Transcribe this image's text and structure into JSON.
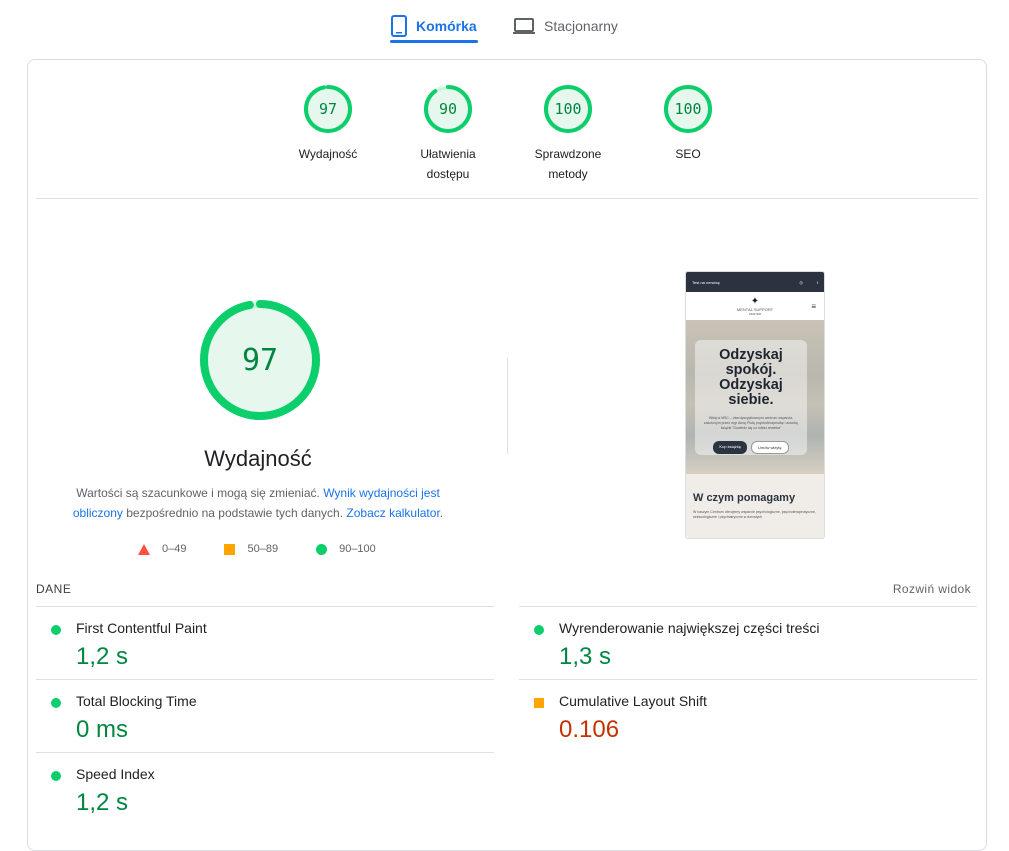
{
  "tabs": [
    {
      "label": "Komórka",
      "icon": "smartphone-icon",
      "active": true
    },
    {
      "label": "Stacjonarny",
      "icon": "laptop-icon",
      "active": false
    }
  ],
  "colors": {
    "accent": "#1a73e8",
    "pass": "#0cce6b",
    "pass_text": "#018642",
    "average": "#ffa400",
    "average_text": "#c33300",
    "fail": "#ff4e42"
  },
  "scores": [
    {
      "value": "97",
      "label_line1": "Wydajność",
      "label_line2": ""
    },
    {
      "value": "90",
      "label_line1": "Ułatwienia",
      "label_line2": "dostępu"
    },
    {
      "value": "100",
      "label_line1": "Sprawdzone",
      "label_line2": "metody"
    },
    {
      "value": "100",
      "label_line1": "SEO",
      "label_line2": ""
    }
  ],
  "main_score": {
    "value": "97",
    "title": "Wydajność"
  },
  "description": {
    "text1": "Wartości są szacunkowe i mogą się zmieniać. ",
    "link1": "Wynik wydajności jest obliczony",
    "text2": " bezpośrednio na podstawie tych danych. ",
    "link2": "Zobacz kalkulator",
    "text3": "."
  },
  "legend": [
    {
      "range": "0–49",
      "shape": "triangle"
    },
    {
      "range": "50–89",
      "shape": "square"
    },
    {
      "range": "90–100",
      "shape": "circle"
    }
  ],
  "screenshot": {
    "topbar": "Test na nerwicę",
    "logo": "MENTAL SUPPORT",
    "logo_sub": "CENTER",
    "hero_heading": "Odzyskaj spokój. Odzyskaj siebie.",
    "hero_text": "Witaj w MSC – interdyscyplinarnym centrum wsparcia, założonym przez mgr Annę Plutę psychoterapeutkę i autorkę książki \"Dowiedz się co lubisz rewelka\"",
    "btn1": "Kup książkę",
    "btn2": "Umów wizytę",
    "section_heading": "W czym pomagamy",
    "section_text": "W naszym Centrum oferujemy wsparcie psychologiczne, psychoterapeutyczne, seksuologiczne i psychiatryczne w dorosłych"
  },
  "metrics_header": {
    "title": "DANE",
    "expand": "Rozwiń widok"
  },
  "metrics": [
    {
      "name": "First Contentful Paint",
      "value": "1,2 s",
      "status": "pass"
    },
    {
      "name": "Wyrenderowanie największej części treści",
      "value": "1,3 s",
      "status": "pass"
    },
    {
      "name": "Total Blocking Time",
      "value": "0 ms",
      "status": "pass"
    },
    {
      "name": "Cumulative Layout Shift",
      "value": "0.106",
      "status": "average"
    },
    {
      "name": "Speed Index",
      "value": "1,2 s",
      "status": "pass"
    }
  ]
}
